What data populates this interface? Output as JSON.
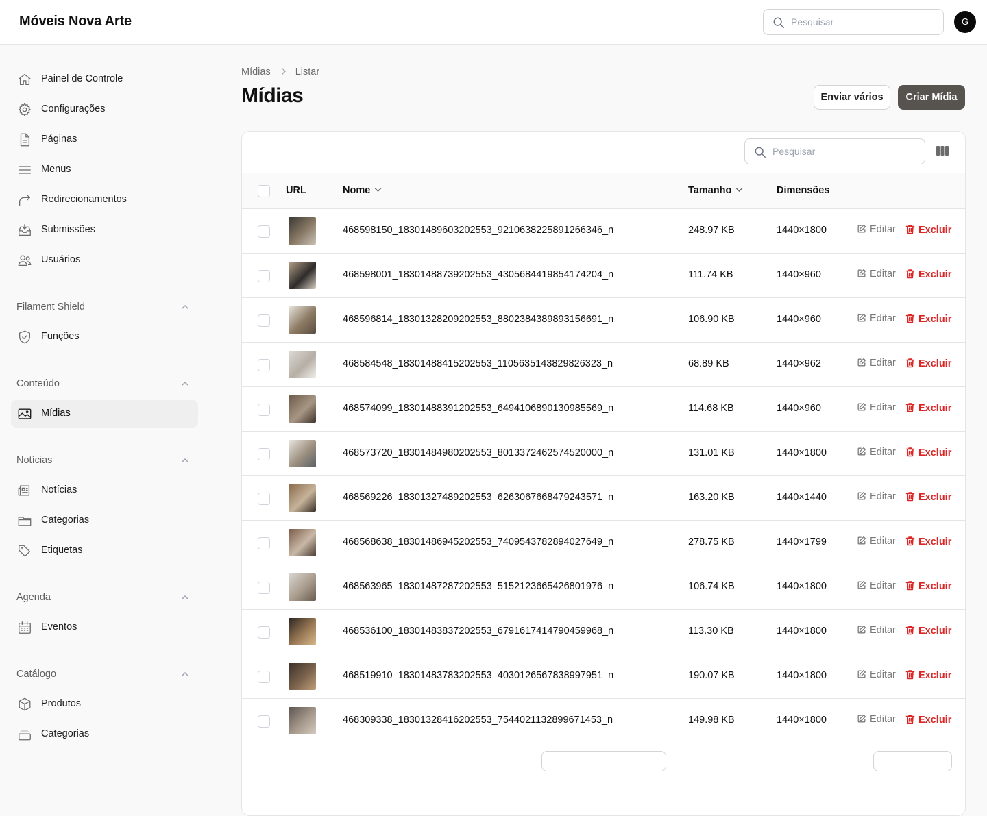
{
  "app": {
    "brand": "Móveis Nova Arte",
    "avatar_initial": "G"
  },
  "top_search": {
    "placeholder": "Pesquisar"
  },
  "sidebar": {
    "items": [
      {
        "label": "Painel de Controle",
        "icon": "home-icon"
      },
      {
        "label": "Configurações",
        "icon": "gear-icon"
      },
      {
        "label": "Páginas",
        "icon": "document-icon"
      },
      {
        "label": "Menus",
        "icon": "menu-lines-icon"
      },
      {
        "label": "Redirecionamentos",
        "icon": "redirect-arrow-icon"
      },
      {
        "label": "Submissões",
        "icon": "inbox-download-icon"
      },
      {
        "label": "Usuários",
        "icon": "users-icon"
      }
    ],
    "groups": [
      {
        "title": "Filament Shield",
        "items": [
          {
            "label": "Funções",
            "icon": "shield-check-icon"
          }
        ]
      },
      {
        "title": "Conteúdo",
        "items": [
          {
            "label": "Mídias",
            "icon": "photo-icon",
            "active": true
          }
        ]
      },
      {
        "title": "Notícias",
        "items": [
          {
            "label": "Notícias",
            "icon": "newspaper-icon"
          },
          {
            "label": "Categorias",
            "icon": "folder-icon"
          },
          {
            "label": "Etiquetas",
            "icon": "tag-icon"
          }
        ]
      },
      {
        "title": "Agenda",
        "items": [
          {
            "label": "Eventos",
            "icon": "calendar-icon"
          }
        ]
      },
      {
        "title": "Catálogo",
        "items": [
          {
            "label": "Produtos",
            "icon": "cube-icon"
          },
          {
            "label": "Categorias",
            "icon": "stack-icon"
          }
        ]
      }
    ]
  },
  "breadcrumb": {
    "first": "Mídias",
    "second": "Listar"
  },
  "page": {
    "title": "Mídias",
    "upload_many_label": "Enviar vários",
    "create_label": "Criar Mídia"
  },
  "table": {
    "search_placeholder": "Pesquisar",
    "columns": {
      "url": "URL",
      "name": "Nome",
      "size": "Tamanho",
      "dimensions": "Dimensões"
    },
    "edit_label": "Editar",
    "delete_label": "Excluir",
    "rows": [
      {
        "name": "468598150_18301489603202553_9210638225891266346_n",
        "size": "248.97 KB",
        "dimensions": "1440×1800"
      },
      {
        "name": "468598001_18301488739202553_4305684419854174204_n",
        "size": "111.74 KB",
        "dimensions": "1440×960"
      },
      {
        "name": "468596814_18301328209202553_8802384389893156691_n",
        "size": "106.90 KB",
        "dimensions": "1440×960"
      },
      {
        "name": "468584548_18301488415202553_1105635143829826323_n",
        "size": "68.89 KB",
        "dimensions": "1440×962"
      },
      {
        "name": "468574099_18301488391202553_6494106890130985569_n",
        "size": "114.68 KB",
        "dimensions": "1440×960"
      },
      {
        "name": "468573720_18301484980202553_8013372462574520000_n",
        "size": "131.01 KB",
        "dimensions": "1440×1800"
      },
      {
        "name": "468569226_18301327489202553_6263067668479243571_n",
        "size": "163.20 KB",
        "dimensions": "1440×1440"
      },
      {
        "name": "468568638_18301486945202553_7409543782894027649_n",
        "size": "278.75 KB",
        "dimensions": "1440×1799"
      },
      {
        "name": "468563965_18301487287202553_5152123665426801976_n",
        "size": "106.74 KB",
        "dimensions": "1440×1800"
      },
      {
        "name": "468536100_18301483837202553_6791617414790459968_n",
        "size": "113.30 KB",
        "dimensions": "1440×1800"
      },
      {
        "name": "468519910_18301483783202553_4030126567838997951_n",
        "size": "190.07 KB",
        "dimensions": "1440×1800"
      },
      {
        "name": "468309338_18301328416202553_7544021132899671453_n",
        "size": "149.98 KB",
        "dimensions": "1440×1800"
      }
    ]
  },
  "colors": {
    "primary_button": "#57534e",
    "danger": "#dc2626",
    "active_nav_bg": "#efefef"
  }
}
